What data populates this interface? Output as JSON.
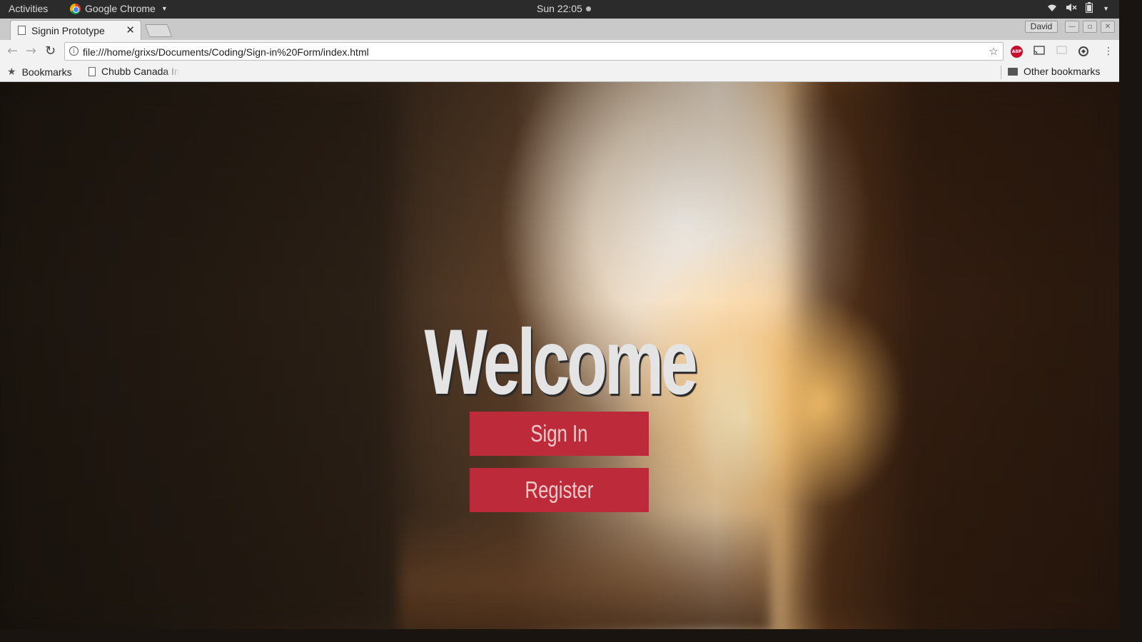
{
  "system_bar": {
    "activities": "Activities",
    "app_name": "Google Chrome",
    "clock": "Sun 22:05"
  },
  "browser": {
    "tab_title": "Signin Prototype",
    "tab_close": "✕",
    "profile_name": "David",
    "url": "file:///home/grixs/Documents/Coding/Sign-in%20Form/index.html",
    "bookmarks_label": "Bookmarks",
    "bookmark_item": "Chubb Canada In",
    "other_bookmarks": "Other bookmarks",
    "extensions": {
      "abp": "ABP"
    }
  },
  "page": {
    "heading": "Welcome",
    "sign_in_label": "Sign In",
    "register_label": "Register",
    "accent_color": "#bd2b3a"
  }
}
